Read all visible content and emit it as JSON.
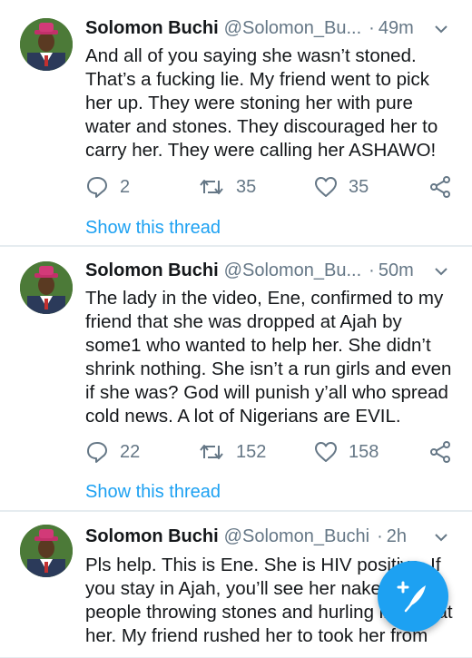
{
  "colors": {
    "accent": "#1da1f2",
    "text": "#14171a",
    "muted": "#657786"
  },
  "tweets": [
    {
      "name": "Solomon Buchi",
      "handle": "@Solomon_Bu...",
      "separator": "·",
      "time": "49m",
      "lines": [
        "And all of you saying she wasn’t stoned.",
        "That’s a fucking lie. My friend went to pick",
        "her up. They were stoning her with pure",
        "water and stones. They discouraged her to",
        "carry her. They were calling her ASHAWO!"
      ],
      "replies": "2",
      "retweets": "35",
      "likes": "35",
      "thread_link": "Show this thread"
    },
    {
      "name": "Solomon Buchi",
      "handle": "@Solomon_Bu...",
      "separator": "·",
      "time": "50m",
      "lines": [
        "The lady in the video, Ene, confirmed to my",
        "friend that she was dropped at Ajah by",
        "some1 who wanted to help her. She didn’t",
        "shrink nothing. She isn’t a run girls and even",
        "if she was? God will punish y’all who spread",
        "cold news. A lot of Nigerians are EVIL."
      ],
      "replies": "22",
      "retweets": "152",
      "likes": "158",
      "thread_link": "Show this thread"
    },
    {
      "name": "Solomon Buchi",
      "handle": "@Solomon_Buchi",
      "separator": "·",
      "time": "2h",
      "lines": [
        "Pls help. This is Ene. She is HIV positive. If",
        "you stay in Ajah, you’ll see her naked with",
        "people throwing stones and hurling insults at",
        "her. My friend rushed her to took her from"
      ]
    }
  ],
  "icons": {
    "reply": "reply-icon",
    "retweet": "retweet-icon",
    "like": "heart-icon",
    "share": "share-icon",
    "menu": "chevron-down-icon",
    "compose": "compose-tweet-icon"
  }
}
